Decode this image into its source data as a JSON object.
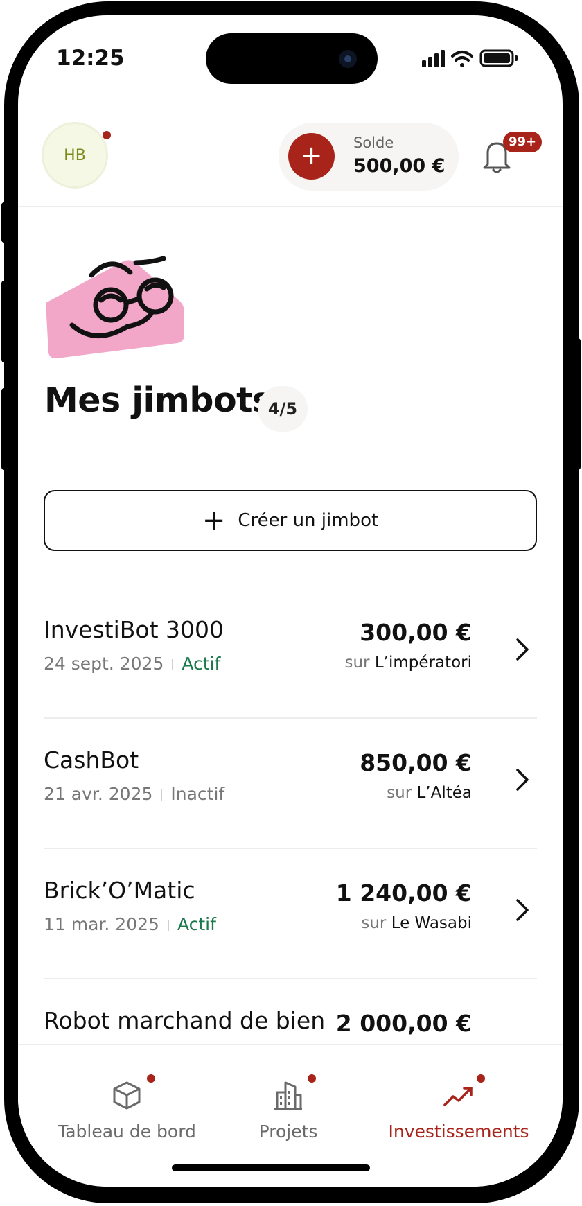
{
  "status_bar": {
    "time": "12:25"
  },
  "header": {
    "avatar_initials": "HB",
    "balance_label": "Solde",
    "balance_value": "500,00 €",
    "notifications_count": "99+"
  },
  "page": {
    "title": "Mes jimbots",
    "count": "4/5"
  },
  "create_button": {
    "label": "Créer un jimbot"
  },
  "jimbots": [
    {
      "name": "InvestiBot 3000",
      "date": "24 sept. 2025",
      "status": "Actif",
      "active": true,
      "amount": "300,00 €",
      "sur": "sur",
      "place": "L’impératori"
    },
    {
      "name": "CashBot",
      "date": "21 avr. 2025",
      "status": "Inactif",
      "active": false,
      "amount": "850,00 €",
      "sur": "sur",
      "place": "L’Altéa"
    },
    {
      "name": "Brick’O’Matic",
      "date": "11 mar. 2025",
      "status": "Actif",
      "active": true,
      "amount": "1 240,00 €",
      "sur": "sur",
      "place": "Le Wasabi"
    },
    {
      "name": "Robot marchand de bien",
      "date": "",
      "status": "",
      "active": false,
      "amount": "2 000,00 €",
      "sur": "",
      "place": ""
    }
  ],
  "tabbar": {
    "dashboard": "Tableau de bord",
    "projects": "Projets",
    "investments": "Investissements"
  },
  "colors": {
    "accent": "#a8241a",
    "active_green": "#1a7a4c",
    "mascot_pink": "#f2a7c8"
  }
}
